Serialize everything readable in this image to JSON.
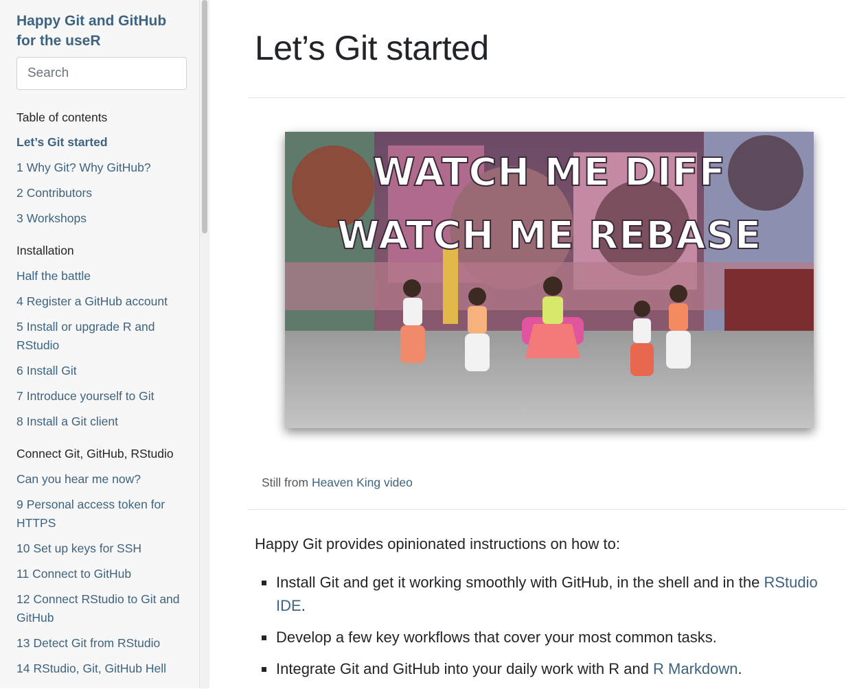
{
  "sidebar": {
    "book_title": "Happy Git and GitHub for the useR",
    "search_placeholder": "Search",
    "toc": [
      {
        "kind": "header",
        "label": "Table of contents"
      },
      {
        "kind": "item",
        "label": "Let’s Git started",
        "active": true
      },
      {
        "kind": "item",
        "num": "1",
        "label": "Why Git? Why GitHub?"
      },
      {
        "kind": "item",
        "num": "2",
        "label": "Contributors"
      },
      {
        "kind": "item",
        "num": "3",
        "label": "Workshops"
      },
      {
        "kind": "header",
        "label": "Installation"
      },
      {
        "kind": "item",
        "label": "Half the battle"
      },
      {
        "kind": "item",
        "num": "4",
        "label": "Register a GitHub account"
      },
      {
        "kind": "item",
        "num": "5",
        "label": "Install or upgrade R and RStudio",
        "lines": 2
      },
      {
        "kind": "item",
        "num": "6",
        "label": "Install Git"
      },
      {
        "kind": "item",
        "num": "7",
        "label": "Introduce yourself to Git"
      },
      {
        "kind": "item",
        "num": "8",
        "label": "Install a Git client"
      },
      {
        "kind": "header",
        "label": "Connect Git, GitHub, RStudio"
      },
      {
        "kind": "item",
        "label": "Can you hear me now?"
      },
      {
        "kind": "item",
        "num": "9",
        "label": "Personal access token for HTTPS",
        "lines": 2
      },
      {
        "kind": "item",
        "num": "10",
        "label": "Set up keys for SSH"
      },
      {
        "kind": "item",
        "num": "11",
        "label": "Connect to GitHub"
      },
      {
        "kind": "item",
        "num": "12",
        "label": "Connect RStudio to Git and GitHub",
        "lines": 2
      },
      {
        "kind": "item",
        "num": "13",
        "label": "Detect Git from RStudio"
      },
      {
        "kind": "item",
        "num": "14",
        "label": "RStudio, Git, GitHub Hell"
      }
    ]
  },
  "main": {
    "title": "Let’s Git started",
    "hero": {
      "line1": "WATCH ME DIFF",
      "line2": "WATCH ME REBASE"
    },
    "caption": {
      "prefix": "Still from ",
      "link": "Heaven King video"
    },
    "intro": "Happy Git provides opinionated instructions on how to:",
    "bullets": [
      {
        "text": "Install Git and get it working smoothly with GitHub, in the shell and in the ",
        "link": "RStudio IDE",
        "suffix": "."
      },
      {
        "text": "Develop a few key workflows that cover your most common tasks.",
        "link": "",
        "suffix": ""
      },
      {
        "text": "Integrate Git and GitHub into your daily work with R and ",
        "link": "R Markdown",
        "suffix": "."
      }
    ]
  },
  "colors": {
    "link": "#3d6380",
    "text": "#212529",
    "sidebar_bg": "#f7f7f7"
  }
}
